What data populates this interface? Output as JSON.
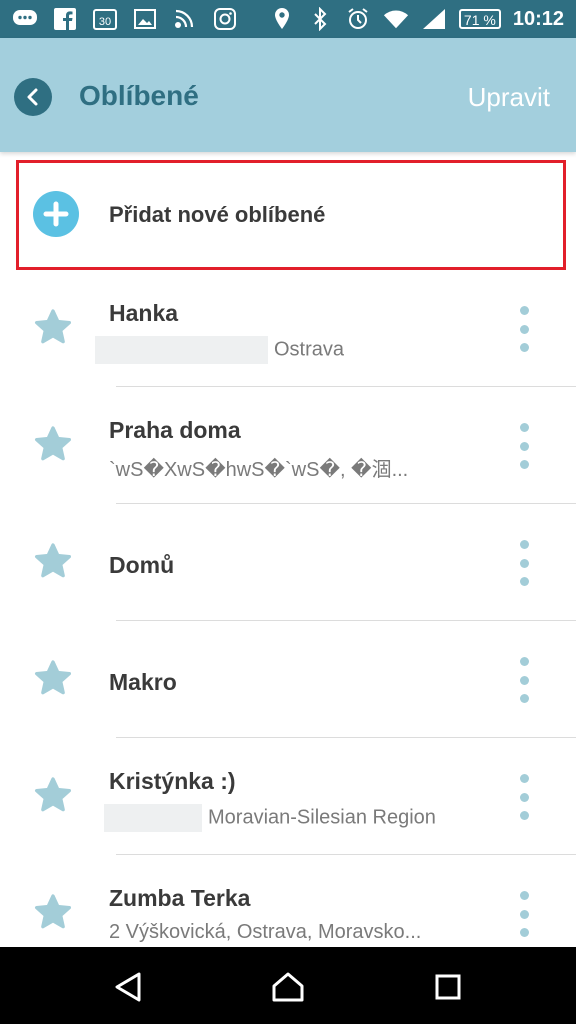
{
  "status_bar": {
    "time": "10:12",
    "battery": "71 %",
    "left_icons": [
      "message-icon",
      "facebook-icon",
      "calendar-icon",
      "image-icon",
      "signal-broadcast-icon",
      "instagram-icon"
    ],
    "right_icons": [
      "location-icon",
      "bluetooth-icon",
      "alarm-icon",
      "wifi-icon",
      "cell-signal-icon"
    ]
  },
  "header": {
    "title": "Oblíbené",
    "edit_label": "Upravit"
  },
  "add_favorite": {
    "label": "Přidat nové oblíbené"
  },
  "favorites": [
    {
      "title": "Hanka",
      "subtitle": "Ostrava",
      "redacted": true
    },
    {
      "title": "Praha doma",
      "subtitle": "`wS�XwS�hwS�`wS�, �涸...",
      "redacted": false
    },
    {
      "title": "Domů",
      "subtitle": "",
      "redacted": false
    },
    {
      "title": "Makro",
      "subtitle": "",
      "redacted": false
    },
    {
      "title": "Kristýnka :)",
      "subtitle": "Moravian-Silesian Region",
      "redacted": true
    },
    {
      "title": "Zumba Terka",
      "subtitle": "2 Výškovická, Ostrava, Moravsko...",
      "redacted": false
    }
  ],
  "colors": {
    "status_bar": "#2f6f82",
    "header": "#a3cfdd",
    "accent": "#2f6f82",
    "add_icon": "#5bc1e3",
    "highlight_border": "#e21f2a",
    "star": "#a3cdd8"
  }
}
